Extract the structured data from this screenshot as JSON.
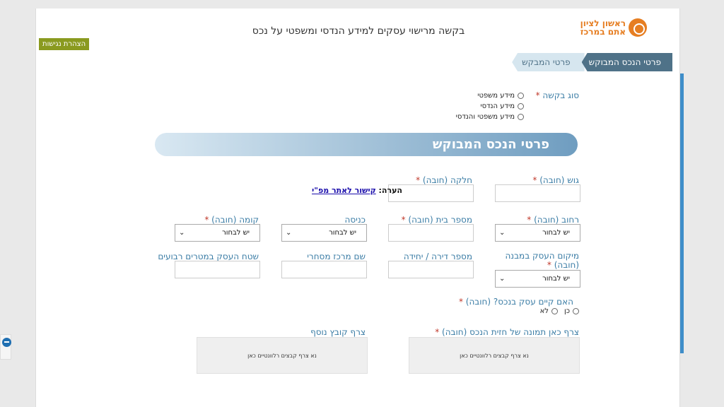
{
  "header": {
    "title": "בקשה מרישוי עסקים למידע הנדסי ומשפטי על נכס",
    "logo_line1": "ראשון לציון",
    "logo_line2": "אתם במרכז",
    "accessibility_badge": "הצהרת נגישות"
  },
  "tabs": [
    {
      "label": "פרטי הנכס המבוקש",
      "active": true
    },
    {
      "label": "פרטי המבקש",
      "active": false
    }
  ],
  "request_type": {
    "label": "סוג בקשה",
    "required_mark": "*",
    "options": [
      "מידע משפטי",
      "מידע הנדסי",
      "מידע משפטי והנדסי"
    ]
  },
  "section_banner": "פרטי הנכס המבוקש",
  "fields": {
    "gush": "גוש (חובה)",
    "helka": "חלקה (חובה)",
    "street": "רחוב (חובה)",
    "house_number": "מספר בית (חובה)",
    "entrance": "כניסה",
    "floor": "קומה (חובה)",
    "business_location": "מיקום העסק במבנה (חובה)",
    "apartment": "מספר דירה / יחידה",
    "mall_name": "שם מרכז מסחרי",
    "business_area": "שטח העסק במטרים רבועים",
    "business_exists": "האם קיים עסק בנכס? (חובה)",
    "photo_upload": "צרף כאן תמונה של חזית הנכס (חובה)",
    "extra_file": "צרף קובץ נוסף"
  },
  "required_mark": "*",
  "select_placeholder": "יש לבחור",
  "yes_no": {
    "yes": "כן",
    "no": "לא"
  },
  "note": {
    "prefix": "הערה:",
    "link": "קישור לאתר מפ\"י"
  },
  "dropzone_text": "נא צרף קבצים רלוונטיים כאן",
  "colors": {
    "accent": "#3a7ca5",
    "tab_active": "#4f7288",
    "tab_inactive": "#d6e6ef",
    "logo": "#e67e22",
    "badge": "#8a9a1f",
    "required": "#c0392b"
  },
  "icons": {
    "logo": "rishon-lezion-logo-icon",
    "side_widget": "accessibility-widget-icon",
    "select_chevron": "chevron-down-icon"
  }
}
